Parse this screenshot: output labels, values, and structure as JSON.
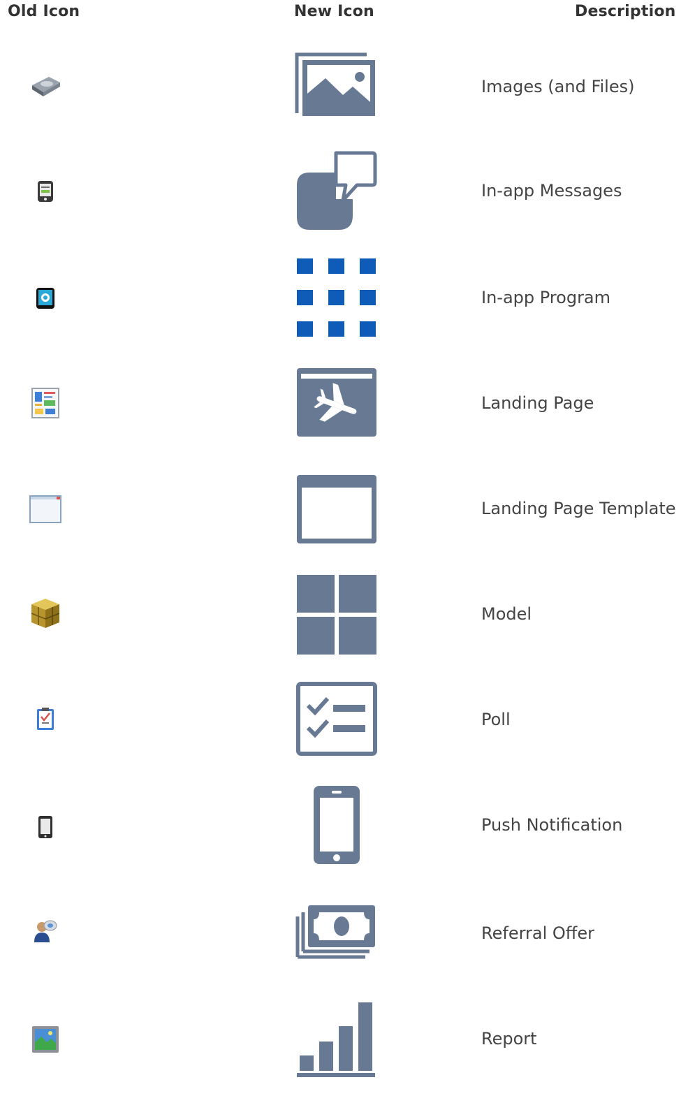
{
  "headers": {
    "old_icon": "Old Icon",
    "new_icon": "New Icon",
    "description": "Description"
  },
  "colors": {
    "icon_slate": "#687a93",
    "icon_blue": "#0f5cb8",
    "text": "#444444"
  },
  "rows": [
    {
      "old_icon": "hard-drive-icon",
      "new_icon": "image-stack-icon",
      "description": "Images (and Files)"
    },
    {
      "old_icon": "phone-message-icon",
      "new_icon": "chat-bubble-icon",
      "description": "In-app Messages"
    },
    {
      "old_icon": "tablet-target-icon",
      "new_icon": "app-grid-icon",
      "description": "In-app Program"
    },
    {
      "old_icon": "page-layout-icon",
      "new_icon": "browser-airplane-icon",
      "description": "Landing Page"
    },
    {
      "old_icon": "blank-window-icon",
      "new_icon": "browser-window-icon",
      "description": "Landing Page Template"
    },
    {
      "old_icon": "gold-cube-icon",
      "new_icon": "four-squares-icon",
      "description": "Model"
    },
    {
      "old_icon": "clipboard-icon",
      "new_icon": "checklist-icon",
      "description": "Poll"
    },
    {
      "old_icon": "phone-icon",
      "new_icon": "smartphone-icon",
      "description": "Push Notification"
    },
    {
      "old_icon": "user-bubble-icon",
      "new_icon": "money-stack-icon",
      "description": "Referral Offer"
    },
    {
      "old_icon": "picture-frame-icon",
      "new_icon": "bar-chart-icon",
      "description": "Report"
    }
  ]
}
